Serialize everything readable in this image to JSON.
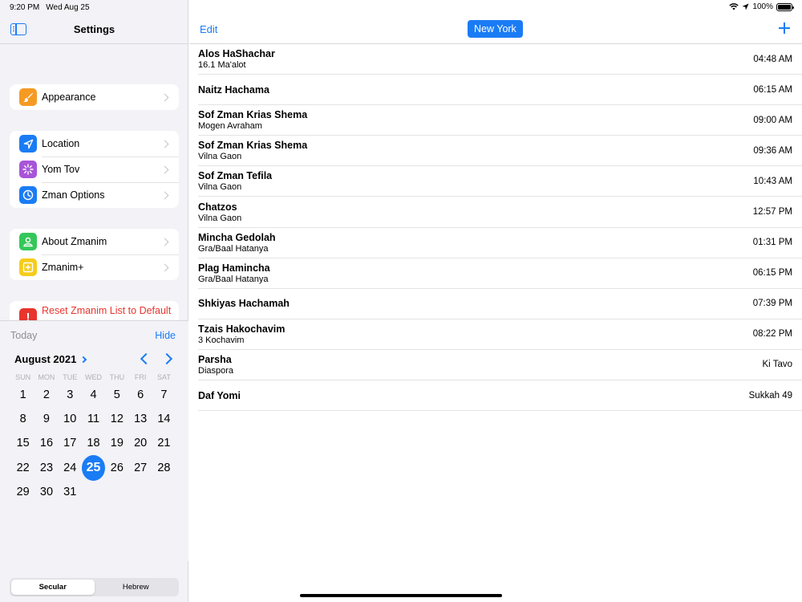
{
  "status_bar": {
    "time": "9:20 PM",
    "date": "Wed Aug 25",
    "battery": "100%",
    "battery_level": 1.0
  },
  "sidebar": {
    "title": "Settings",
    "groups": [
      [
        {
          "label": "Appearance",
          "icon": "paintbrush-icon",
          "color": "#f59b23"
        }
      ],
      [
        {
          "label": "Location",
          "icon": "location-arrow-icon",
          "color": "#1a7cf5"
        },
        {
          "label": "Yom Tov",
          "icon": "sparkle-icon",
          "color": "#a855d8"
        },
        {
          "label": "Zman Options",
          "icon": "clock-icon",
          "color": "#1a7cf5"
        }
      ],
      [
        {
          "label": "About Zmanim",
          "icon": "person-icon",
          "color": "#34c759"
        },
        {
          "label": "Zmanim+",
          "icon": "plus-square-icon",
          "color": "#f5cc1a"
        }
      ]
    ],
    "reset": {
      "label": "Reset Zmanim List to Default",
      "icon": "exclamation-icon",
      "color": "#e8352d"
    }
  },
  "calendar": {
    "today_label": "Today",
    "hide_label": "Hide",
    "month_label": "August 2021",
    "weekdays": [
      "SUN",
      "MON",
      "TUE",
      "WED",
      "THU",
      "FRI",
      "SAT"
    ],
    "days": [
      "1",
      "2",
      "3",
      "4",
      "5",
      "6",
      "7",
      "8",
      "9",
      "10",
      "11",
      "12",
      "13",
      "14",
      "15",
      "16",
      "17",
      "18",
      "19",
      "20",
      "21",
      "22",
      "23",
      "24",
      "25",
      "26",
      "27",
      "28",
      "29",
      "30",
      "31"
    ],
    "selected_day": "25",
    "modes": [
      "Secular",
      "Hebrew"
    ],
    "active_mode": "Secular"
  },
  "main": {
    "edit_label": "Edit",
    "city": "New York",
    "zmanim": [
      {
        "name": "Alos HaShachar",
        "sub": "16.1 Ma'alot",
        "value": "04:48 AM"
      },
      {
        "name": "Naitz Hachama",
        "sub": "",
        "value": "06:15 AM"
      },
      {
        "name": "Sof Zman Krias Shema",
        "sub": "Mogen Avraham",
        "value": "09:00 AM"
      },
      {
        "name": "Sof Zman Krias Shema",
        "sub": "Vilna Gaon",
        "value": "09:36 AM"
      },
      {
        "name": "Sof Zman Tefila",
        "sub": "Vilna Gaon",
        "value": "10:43 AM"
      },
      {
        "name": "Chatzos",
        "sub": "Vilna Gaon",
        "value": "12:57 PM"
      },
      {
        "name": "Mincha Gedolah",
        "sub": "Gra/Baal Hatanya",
        "value": "01:31 PM"
      },
      {
        "name": "Plag Hamincha",
        "sub": "Gra/Baal Hatanya",
        "value": "06:15 PM"
      },
      {
        "name": "Shkiyas Hachamah",
        "sub": "",
        "value": "07:39 PM"
      },
      {
        "name": "Tzais Hakochavim",
        "sub": "3 Kochavim",
        "value": "08:22 PM"
      },
      {
        "name": "Parsha",
        "sub": "Diaspora",
        "value": "Ki Tavo"
      },
      {
        "name": "Daf Yomi",
        "sub": "",
        "value": "Sukkah 49"
      }
    ]
  }
}
